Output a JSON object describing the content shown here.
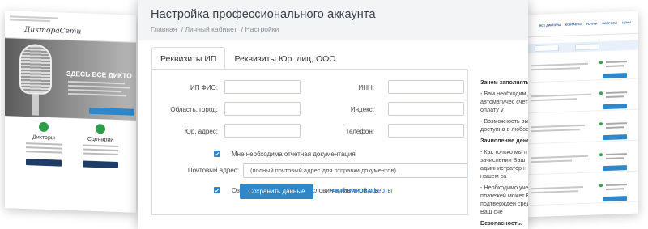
{
  "left_screenshot": {
    "logo_text": "ДиктораСети",
    "hero_title": "ЗДЕСЬ ВСЕ ДИКТО",
    "feature_1": "Дикторы",
    "feature_2": "Сценарии"
  },
  "right_screenshot": {
    "nav_items": [
      "ВСЕ ДИКТОРЫ",
      "КОНТАКТЫ",
      "УСЛУГИ",
      "ВОПРОСЫ",
      "ЦЕНЫ"
    ]
  },
  "main": {
    "page_title": "Настройка профессионального аккаунта",
    "breadcrumbs": [
      "Главная",
      "/ Личный кабинет",
      "/ Настройки"
    ],
    "tabs": [
      {
        "label": "Реквизиты ИП",
        "active": true
      },
      {
        "label": "Реквизиты Юр. лиц, ООО",
        "active": false
      }
    ],
    "form": {
      "fio_label": "ИП ФИО:",
      "inn_label": "ИНН:",
      "city_label": "Область, город:",
      "index_label": "Индекс:",
      "address_label": "Юр. адрес:",
      "phone_label": "Телефон:",
      "docs_checkbox_label": "Мне необходима отчетная документация",
      "docs_checked": true,
      "postal_label": "Почтовый адрес:",
      "postal_placeholder": "(полный почтовый адрес для отправки документов)",
      "agree_text": "Ознакомлен и принимаю условия",
      "agree_link": "публичной оферты",
      "agree_checked": true,
      "save_button": "Сохранить данные",
      "activate_link": "*АКТИВИРОВАТЬ"
    },
    "sidebar": {
      "heading_1": "Зачем заполнять р",
      "text_1": "- Вам необходим для автоматичес счета на оплату у",
      "text_2": "- Возможность вы доступна в любое",
      "heading_2": "Зачисление денег с",
      "text_3": "- Как только мы п зачислении Ваш администратор н счет на нашем са",
      "text_4": "- Необходимо уче платежей может Без подтвержден средств - Ваш сче",
      "heading_3": "Безопасность."
    }
  },
  "colors": {
    "accent": "#2f86c9",
    "link": "#2f6fb5",
    "header_bg": "#f3f4f6"
  }
}
